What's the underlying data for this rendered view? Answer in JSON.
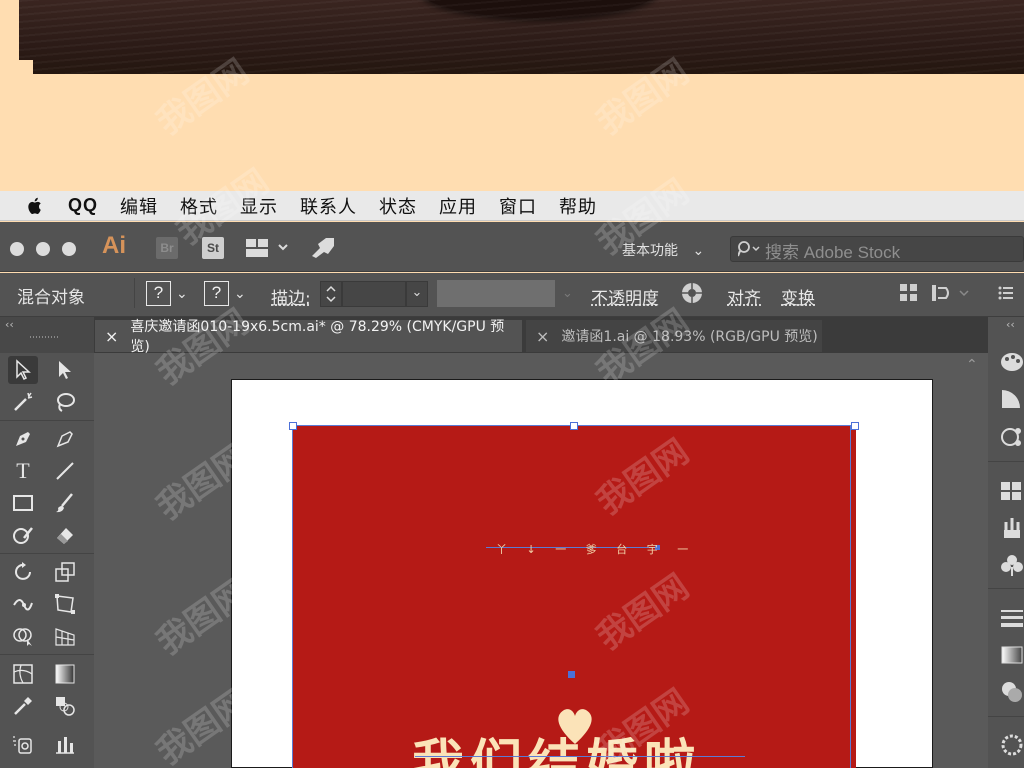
{
  "menubar": {
    "apple": "apple-logo",
    "items": [
      "QQ",
      "编辑",
      "格式",
      "显示",
      "联系人",
      "状态",
      "应用",
      "窗口",
      "帮助"
    ]
  },
  "appbar": {
    "app_logo": "Ai",
    "bridge": "Br",
    "stock": "St",
    "workspace": "基本功能",
    "search_placeholder": "搜索 Adobe Stock"
  },
  "control_bar": {
    "object_type": "混合对象",
    "fill_value": "?",
    "stroke_value": "?",
    "stroke_label": "描边:",
    "opacity_label": "不透明度",
    "align_label": "对齐",
    "transform_label": "变换"
  },
  "tabs": [
    {
      "title": "喜庆邀请函010-19x6.5cm.ai* @ 78.29% (CMYK/GPU 预览)",
      "close": "×"
    },
    {
      "title": "邀请函1.ai @ 18.93% (RGB/GPU 预览)",
      "close": "×"
    }
  ],
  "colors": {
    "card_red": "#b51a16",
    "panel_grey": "#535353",
    "peach": "#ffddb1",
    "selection_blue": "#5b7bd5"
  },
  "artwork": {
    "big_text": "我们结婚啦",
    "small_line_text": "丫 ↓ 一 爹 台 宇 一"
  },
  "watermark": "我图网"
}
